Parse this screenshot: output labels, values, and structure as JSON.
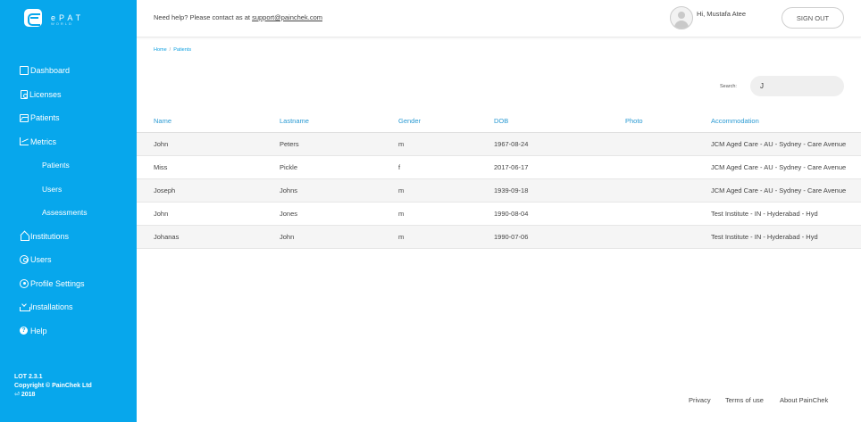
{
  "app": {
    "logo_text": "ePAT",
    "logo_sub": "WORLD"
  },
  "sidebar": {
    "items": [
      {
        "label": "Dashboard",
        "icon": "dashboard-icon"
      },
      {
        "label": "Licenses",
        "icon": "license-icon"
      },
      {
        "label": "Patients",
        "icon": "patients-icon"
      },
      {
        "label": "Metrics",
        "icon": "metrics-icon"
      },
      {
        "label": "Patients",
        "icon": null
      },
      {
        "label": "Users",
        "icon": null
      },
      {
        "label": "Assessments",
        "icon": null
      },
      {
        "label": "Institutions",
        "icon": "institution-icon"
      },
      {
        "label": "Users",
        "icon": "users-icon"
      },
      {
        "label": "Profile Settings",
        "icon": "settings-icon"
      },
      {
        "label": "Installations",
        "icon": "installations-icon"
      },
      {
        "label": "Help",
        "icon": "help-icon"
      }
    ],
    "version": "LOT 2.3.1",
    "copyright": "Copyright © PainChek Ltd",
    "year": "2018"
  },
  "header": {
    "help_prefix": "Need help? Please contact as at ",
    "help_email": "support@painchek.com",
    "user_name": "Hi, Mustafa Atee",
    "signout_label": "SIGN OUT"
  },
  "breadcrumb": {
    "home": "Home",
    "separator": "/",
    "current": "Patients"
  },
  "search": {
    "label": "Search:",
    "value": "J"
  },
  "table": {
    "headers": [
      "Name",
      "Lastname",
      "Gender",
      "DOB",
      "Photo",
      "Accommodation"
    ],
    "rows": [
      [
        "John",
        "Peters",
        "m",
        "1967-08-24",
        "",
        "JCM Aged Care - AU - Sydney - Care Avenue"
      ],
      [
        "Miss",
        "Pickle",
        "f",
        "2017-06-17",
        "",
        "JCM Aged Care - AU - Sydney - Care Avenue"
      ],
      [
        "Joseph",
        "Johns",
        "m",
        "1939-09-18",
        "",
        "JCM Aged Care - AU - Sydney - Care Avenue"
      ],
      [
        "John",
        "Jones",
        "m",
        "1990-08-04",
        "",
        "Test Institute - IN - Hyderabad - Hyd"
      ],
      [
        "Johanas",
        "John",
        "m",
        "1990-07-06",
        "",
        "Test Institute - IN - Hyderabad - Hyd"
      ]
    ]
  },
  "footer": {
    "privacy": "Privacy",
    "terms": "Terms of use",
    "about": "About PainChek"
  },
  "colors": {
    "sidebar_bg": "#07a7ec",
    "header_link": "#2a9ad3",
    "stripe": "#f5f5f5"
  }
}
